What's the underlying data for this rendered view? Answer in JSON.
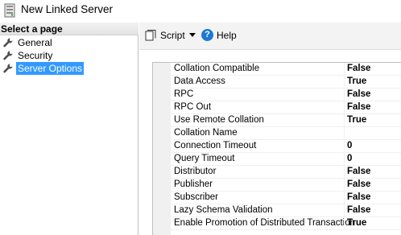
{
  "window": {
    "title": "New Linked Server",
    "icon": "linked-server-icon"
  },
  "left_panel": {
    "header": "Select a page",
    "pages": [
      {
        "label": "General",
        "icon": "wrench-icon",
        "selected": false
      },
      {
        "label": "Security",
        "icon": "wrench-icon",
        "selected": false
      },
      {
        "label": "Server Options",
        "icon": "wrench-icon",
        "selected": true
      }
    ]
  },
  "toolbar": {
    "script_label": "Script",
    "script_icon": "script-icon",
    "help_label": "Help",
    "help_icon": "help-icon"
  },
  "properties": [
    {
      "name": "Collation Compatible",
      "value": "False"
    },
    {
      "name": "Data Access",
      "value": "True"
    },
    {
      "name": "RPC",
      "value": "False"
    },
    {
      "name": "RPC Out",
      "value": "False"
    },
    {
      "name": "Use Remote Collation",
      "value": "True"
    },
    {
      "name": "Collation Name",
      "value": ""
    },
    {
      "name": "Connection Timeout",
      "value": "0"
    },
    {
      "name": "Query Timeout",
      "value": "0"
    },
    {
      "name": "Distributor",
      "value": "False"
    },
    {
      "name": "Publisher",
      "value": "False"
    },
    {
      "name": "Subscriber",
      "value": "False"
    },
    {
      "name": "Lazy Schema Validation",
      "value": "False"
    },
    {
      "name": "Enable Promotion of Distributed Transaction",
      "value": "True"
    }
  ],
  "colors": {
    "selection": "#3399ff",
    "help_blue": "#1e78d4"
  }
}
